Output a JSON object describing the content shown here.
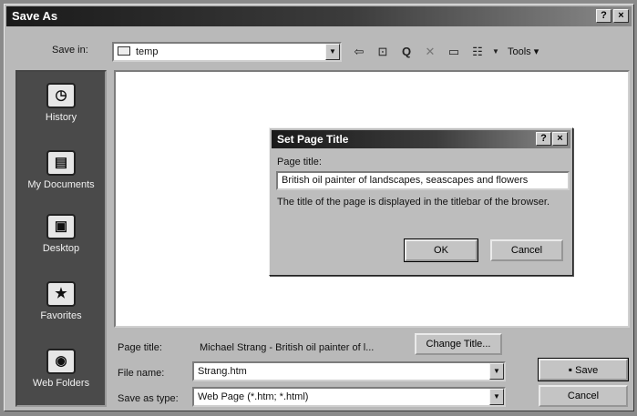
{
  "window": {
    "title": "Save As",
    "help_btn": "?",
    "close_btn": "×"
  },
  "save_in": {
    "label": "Save in:",
    "value": "temp"
  },
  "toolbar": {
    "icons": [
      "back-arrow-icon",
      "up-folder-icon",
      "search-web-icon",
      "delete-icon",
      "new-folder-icon",
      "views-icon"
    ],
    "tools_label": "Tools"
  },
  "places": [
    {
      "label": "History",
      "icon": "history-icon"
    },
    {
      "label": "My Documents",
      "icon": "my-documents-icon"
    },
    {
      "label": "Desktop",
      "icon": "desktop-icon"
    },
    {
      "label": "Favorites",
      "icon": "favorites-icon"
    },
    {
      "label": "Web Folders",
      "icon": "web-folders-icon"
    }
  ],
  "page_title": {
    "label": "Page title:",
    "value": "Michael Strang - British oil painter of l...",
    "change_button": "Change Title..."
  },
  "file_name": {
    "label": "File name:",
    "value": "Strang.htm"
  },
  "save_as_type": {
    "label": "Save as type:",
    "value": "Web Page (*.htm; *.html)"
  },
  "buttons": {
    "save": "Save",
    "cancel": "Cancel"
  },
  "set_page_title_dialog": {
    "title": "Set Page Title",
    "help_btn": "?",
    "close_btn": "×",
    "field_label": "Page title:",
    "field_value": "British oil painter of landscapes, seascapes and flowers",
    "description": "The title of the page is displayed in the titlebar of the browser.",
    "ok": "OK",
    "cancel": "Cancel"
  }
}
